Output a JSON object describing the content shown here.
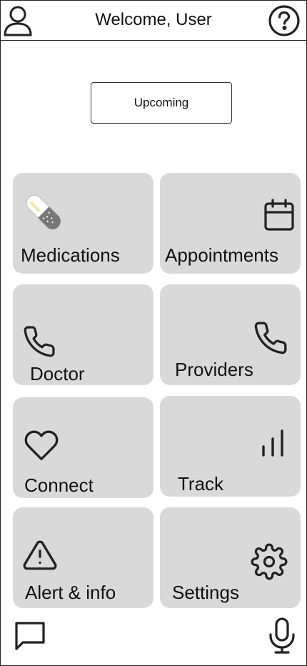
{
  "header": {
    "title": "Welcome, User",
    "profile_icon": "user-icon",
    "help_icon": "help-circle-icon"
  },
  "upcoming": {
    "label": "Upcoming"
  },
  "tiles": [
    {
      "label": "Medications",
      "icon": "pill-icon"
    },
    {
      "label": "Appointments",
      "icon": "calendar-icon"
    },
    {
      "label": "Doctor",
      "icon": "phone-icon"
    },
    {
      "label": "Providers",
      "icon": "phone-icon"
    },
    {
      "label": "Connect",
      "icon": "heart-icon"
    },
    {
      "label": "Track",
      "icon": "signal-bars-icon"
    },
    {
      "label": "Alert & info",
      "icon": "alert-triangle-icon"
    },
    {
      "label": "Settings",
      "icon": "gear-icon"
    }
  ],
  "footer": {
    "chat_icon": "chat-icon",
    "mic_icon": "microphone-icon"
  },
  "colors": {
    "tile_bg": "#d9d9d9",
    "line": "#222222",
    "pill_gray": "#777777",
    "pill_accent": "#f2e6a8"
  }
}
